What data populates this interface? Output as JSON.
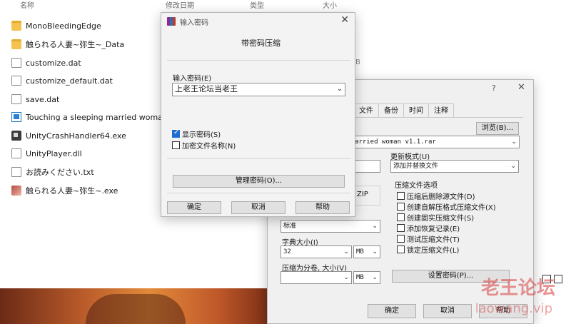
{
  "explorer": {
    "columns": {
      "name": "名称",
      "modified": "修改日期",
      "type": "类型",
      "size": "大小"
    },
    "files": [
      {
        "name": "MonoBleedingEdge",
        "icon": "folder-icon"
      },
      {
        "name": "触られる人妻~弥生~_Data",
        "icon": "folder-icon"
      },
      {
        "name": "customize.dat",
        "icon": "document-icon"
      },
      {
        "name": "customize_default.dat",
        "icon": "document-icon"
      },
      {
        "name": "save.dat",
        "icon": "document-icon"
      },
      {
        "name": "Touching a sleeping married woman ...",
        "icon": "window-icon"
      },
      {
        "name": "UnityCrashHandler64.exe",
        "icon": "exe-icon"
      },
      {
        "name": "UnityPlayer.dll",
        "icon": "document-icon"
      },
      {
        "name": "お読みください.txt",
        "icon": "text-icon"
      },
      {
        "name": "触られる人妻~弥生~.exe",
        "icon": "image-icon"
      }
    ],
    "size_fragment": "B"
  },
  "archive_dialog": {
    "help_glyph": "?",
    "close_glyph": "✕",
    "tabs": [
      "文件",
      "备份",
      "时间",
      "注释"
    ],
    "browse_label": "浏览(B)...",
    "archive_name": "arried woman v1.1.rar",
    "update_mode_label": "更新模式(U)",
    "update_mode_value": "添加并替换文件",
    "zip_label": "ZIP",
    "options_title": "压缩文件选项",
    "options": [
      {
        "label": "压缩后删除源文件(D)",
        "checked": false
      },
      {
        "label": "创建自解压格式压缩文件(X)",
        "checked": false
      },
      {
        "label": "创建固实压缩文件(S)",
        "checked": false
      },
      {
        "label": "添加恢复记录(E)",
        "checked": false
      },
      {
        "label": "测试压缩文件(T)",
        "checked": false
      },
      {
        "label": "锁定压缩文件(L)",
        "checked": false
      }
    ],
    "method_value": "标准",
    "dict_label": "字典大小(I)",
    "dict_value": "32",
    "dict_unit": "MB",
    "split_label": "压缩为分卷, 大小(V)",
    "split_value": "",
    "split_unit": "MB",
    "set_password_button": "设置密码(P)...",
    "ok_button": "确定",
    "cancel_button": "取消",
    "help_button": "帮助"
  },
  "password_dialog": {
    "title": "输入密码",
    "heading": "带密码压缩",
    "password_label": "输入密码(E)",
    "password_value": "上老王论坛当老王",
    "show_password_label": "显示密码(S)",
    "show_password_checked": true,
    "encrypt_names_label": "加密文件名称(N)",
    "encrypt_names_checked": false,
    "manage_button": "管理密码(O)...",
    "ok_button": "确定",
    "cancel_button": "取消",
    "help_button": "帮助",
    "close_glyph": "✕"
  },
  "watermark": {
    "text": "老王论坛",
    "sub": "laowang.vip"
  },
  "colors": {
    "accent": "#1f6fd1",
    "watermark": "#d63c3c"
  }
}
